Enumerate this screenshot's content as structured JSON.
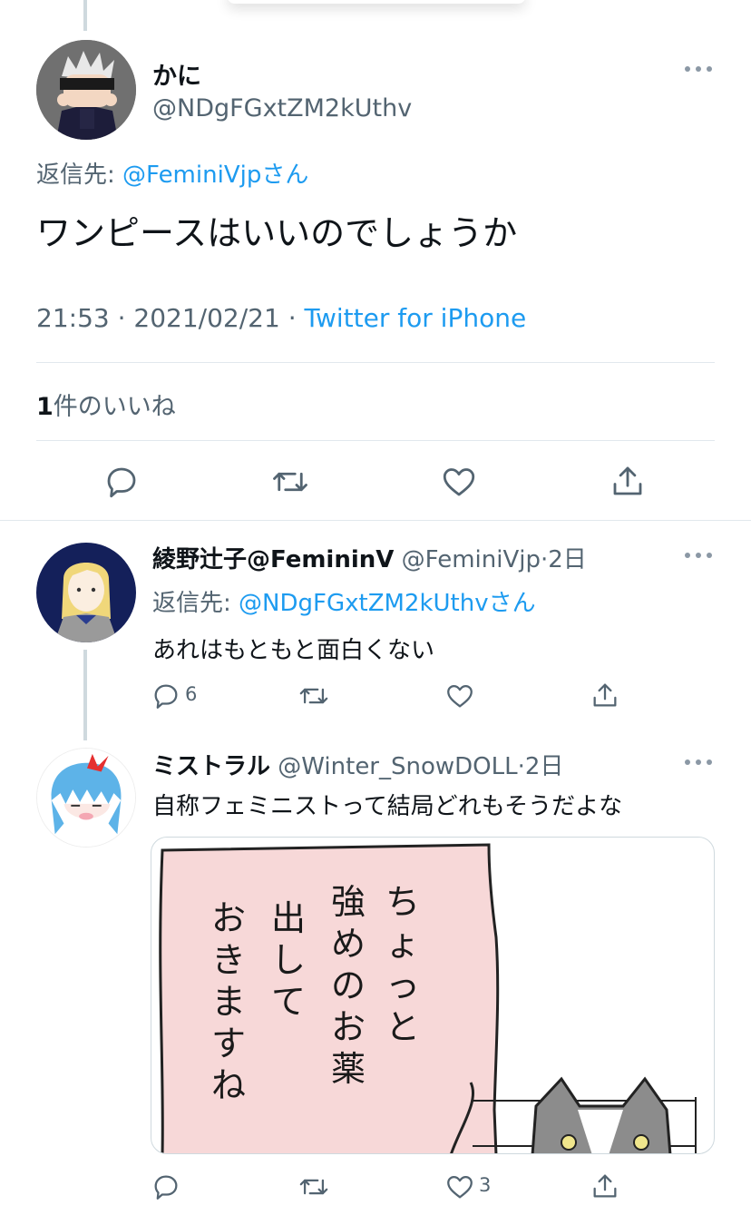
{
  "main_tweet": {
    "display_name": "かに",
    "handle": "@NDgFGxtZM2kUthv",
    "reply_prefix": "返信先:",
    "reply_to": "@FeminiVjpさん",
    "text": "ワンピースはいいのでしょうか",
    "time": "21:53",
    "date": "2021/02/21",
    "sep1": "·",
    "sep2": "·",
    "source": "Twitter for iPhone",
    "likes_count": "1",
    "likes_label": "件のいいね"
  },
  "reply1": {
    "display_name": "綾野辻子@FemininV",
    "handle": "@FeminiVjp",
    "sep": "·",
    "age": "2日",
    "reply_prefix": "返信先:",
    "reply_to": "@NDgFGxtZM2kUthvさん",
    "text": "あれはもともと面白くない",
    "reply_count": "6",
    "retweet_count": "",
    "like_count": ""
  },
  "reply2": {
    "display_name": "ミストラル",
    "handle": "@Winter_SnowDOLL",
    "sep": "·",
    "age": "2日",
    "text": "自称フェミニストって結局どれもそうだよな",
    "image_text_col1": "ちょっと",
    "image_text_col2": "強めのお薬",
    "image_text_col3": "出して",
    "image_text_col4": "おきますね",
    "reply_count": "",
    "retweet_count": "",
    "like_count": "3"
  },
  "icons": [
    "more-icon",
    "reply-icon",
    "retweet-icon",
    "like-icon",
    "share-icon"
  ],
  "colors": {
    "link": "#1d9bf0",
    "secondary": "#536471",
    "divider": "#e1e8ed",
    "thread": "#cfd9de",
    "speech_bubble": "#f7d8d8"
  }
}
